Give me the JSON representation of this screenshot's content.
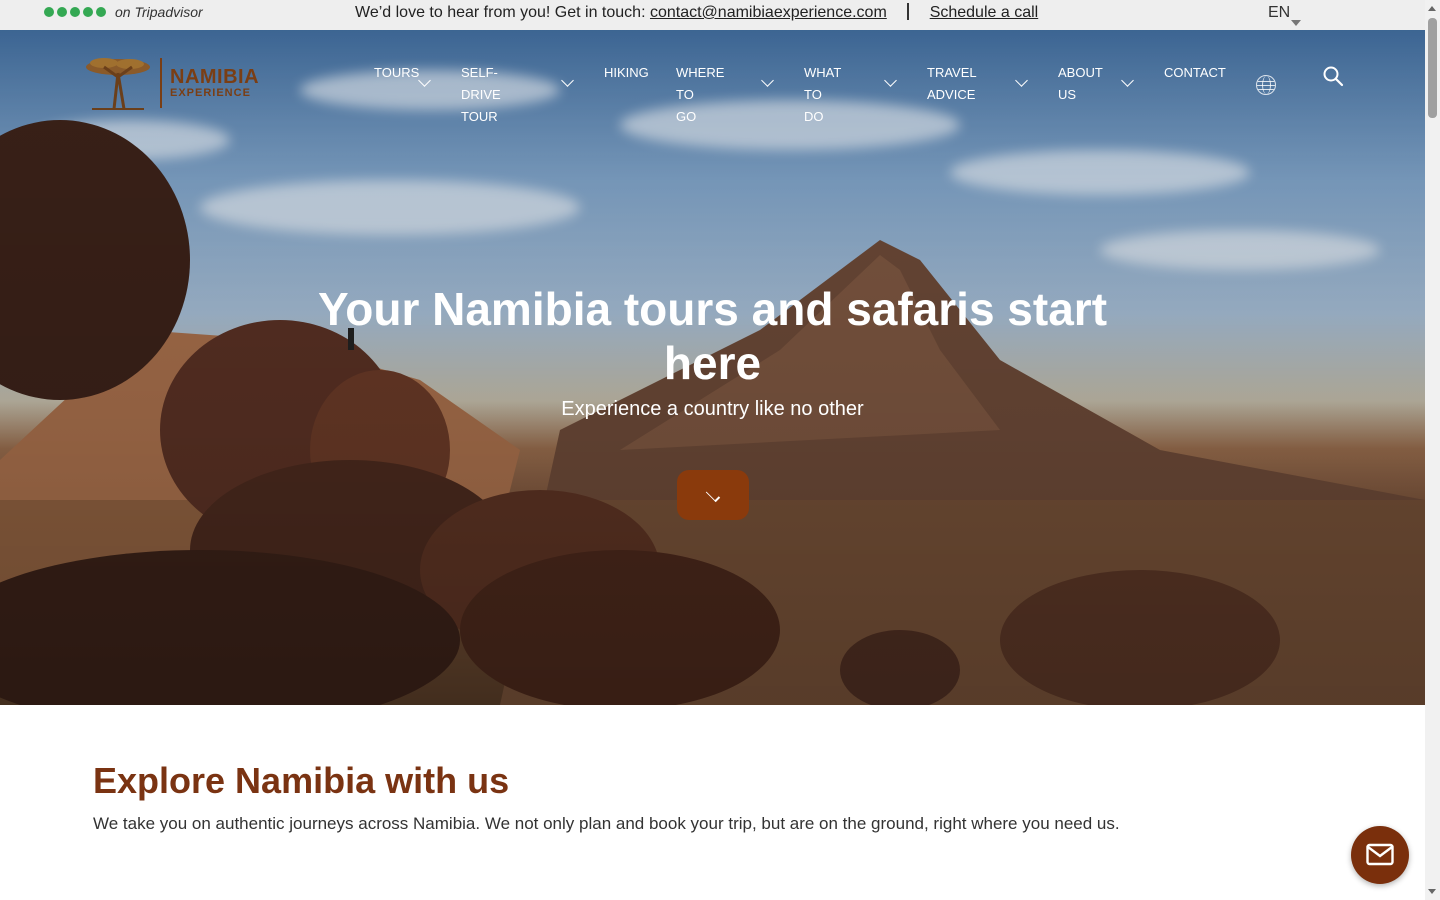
{
  "topbar": {
    "rating_text": "on Tripadvisor",
    "rating_dots": 5,
    "contact_prefix": "We’d love to hear from you! Get in touch:",
    "contact_email": "contact@namibiaexperience.com",
    "schedule_link": "Schedule a call",
    "language": "EN"
  },
  "header": {
    "logo_line1": "NAMIBIA",
    "logo_line2": "EXPERIENCE",
    "nav": [
      {
        "label": "TOURS",
        "dropdown": true
      },
      {
        "label": "SELF-DRIVE\nTOUR",
        "dropdown": true
      },
      {
        "label": "HIKING",
        "dropdown": false
      },
      {
        "label": "WHERE TO\nGO",
        "dropdown": true
      },
      {
        "label": "WHAT TO\nDO",
        "dropdown": true
      },
      {
        "label": "TRAVEL\nADVICE",
        "dropdown": true
      },
      {
        "label": "ABOUT\nUS",
        "dropdown": true
      },
      {
        "label": "CONTACT",
        "dropdown": false
      }
    ]
  },
  "hero": {
    "title": "Your Namibia tours and safaris start here",
    "subtitle": "Experience a country like no other"
  },
  "intro": {
    "title": "Explore Namibia with us",
    "text": "We take you on authentic journeys across Namibia. We not only plan and book your trip, but are on the ground, right where you need us."
  },
  "colors": {
    "brand_brown": "#7a3312",
    "cta_brown": "#8a3a0c",
    "tripadvisor_green": "#34a853"
  }
}
